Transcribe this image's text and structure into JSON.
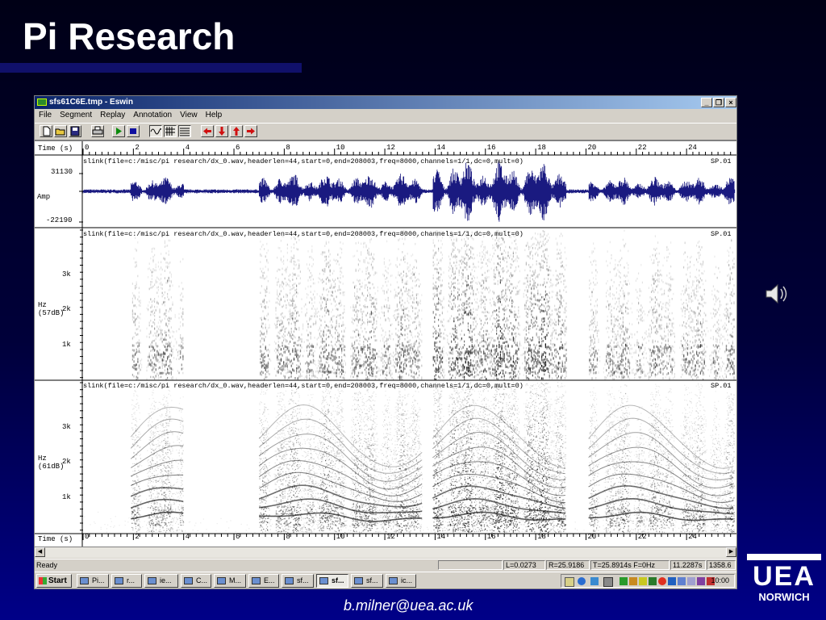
{
  "slide": {
    "title": "Pi Research",
    "email": "b.milner@uea.ac.uk",
    "logo_text_top": "UEA",
    "logo_text_bottom": "NORWICH"
  },
  "window": {
    "title": "sfs61C6E.tmp - Eswin",
    "controls": [
      "minimize-icon",
      "restore-icon",
      "close-icon"
    ],
    "menu": [
      "File",
      "Segment",
      "Replay",
      "Annotation",
      "View",
      "Help"
    ],
    "toolbar": [
      "new-file-icon",
      "open-folder-icon",
      "save-icon",
      "print-icon",
      "play-icon",
      "stop-icon",
      "waveform-view-icon",
      "spectrogram-view-icon",
      "lines-view-icon",
      "arrow-left-icon",
      "arrow-down-icon",
      "arrow-up-icon",
      "arrow-right-icon"
    ]
  },
  "time_axis": {
    "label": "Time (s)",
    "ticks": [
      "0",
      "2",
      "4",
      "6",
      "8",
      "10",
      "12",
      "14",
      "16",
      "18",
      "20",
      "22",
      "24"
    ]
  },
  "panels": [
    {
      "type": "waveform",
      "source": "slink(file=c:/misc/pi research/dx_0.wav,headerlen=44,start=0,end=208003,freq=8000,channels=1/1,dc=0,mult=0)",
      "tag": "SP.01",
      "y_top": "31130",
      "y_label": "Amp",
      "y_bottom": "-22190"
    },
    {
      "type": "spectrogram-wideband",
      "source": "slink(file=c:/misc/pi research/dx_0.wav,headerlen=44,start=0,end=208003,freq=8000,channels=1/1,dc=0,mult=0)",
      "tag": "SP.01",
      "y_label": "Hz",
      "y_range": "(57dB)",
      "ticks": [
        "3k",
        "2k",
        "1k"
      ]
    },
    {
      "type": "spectrogram-narrowband",
      "source": "slink(file=c:/misc/pi research/dx_0.wav,headerlen=44,start=0,end=208003,freq=8000,channels=1/1,dc=0,mult=0)",
      "tag": "SP.01",
      "y_label": "Hz",
      "y_range": "(61dB)",
      "ticks": [
        "3k",
        "2k",
        "1k"
      ]
    }
  ],
  "status": {
    "text": "Ready",
    "left": "L=0.0273",
    "right": "R=25.9186",
    "time": "T=25.8914s F=0Hz",
    "duration": "11.2287s",
    "extra": "1358.6"
  },
  "taskbar": {
    "start": "Start",
    "buttons": [
      "Pi...",
      "r...",
      "ie...",
      "C...",
      "M...",
      "E...",
      "sf...",
      "sf...",
      "sf...",
      "ic..."
    ],
    "active_index": 7,
    "clock": "10:00"
  }
}
